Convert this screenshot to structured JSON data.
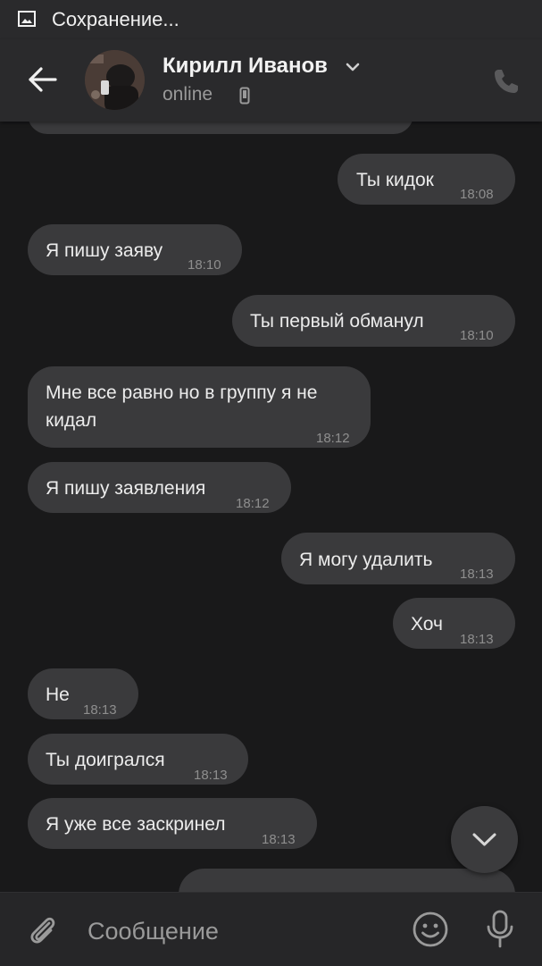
{
  "status_bar": {
    "text": "Сохранение...",
    "icon": "image-icon"
  },
  "header": {
    "back_icon": "arrow-left-icon",
    "contact_name": "Кирилл Иванов",
    "status": "online",
    "status_icon": "mobile-phone-icon",
    "call_icon": "phone-icon"
  },
  "messages": [
    {
      "side": "out",
      "text": "Ты кидок",
      "time": "18:08"
    },
    {
      "side": "in",
      "text": "Я пишу заяву",
      "time": "18:10"
    },
    {
      "side": "out",
      "text": "Ты первый обманул",
      "time": "18:10"
    },
    {
      "side": "in",
      "text": "Мне все равно но в группу я не кидал",
      "time": "18:12"
    },
    {
      "side": "in",
      "text": "Я пишу заявления",
      "time": "18:12"
    },
    {
      "side": "out",
      "text": "Я могу удалить",
      "time": "18:13"
    },
    {
      "side": "out",
      "text": "Хоч",
      "time": "18:13"
    },
    {
      "side": "in",
      "text": "Не",
      "time": "18:13"
    },
    {
      "side": "in",
      "text": "Ты доигрался",
      "time": "18:13"
    },
    {
      "side": "in",
      "text": "Я уже все заскринел",
      "time": "18:13"
    }
  ],
  "composer": {
    "placeholder": "Сообщение",
    "attach_icon": "paperclip-icon",
    "emoji_icon": "smiley-icon",
    "mic_icon": "microphone-icon"
  },
  "scroll_down_icon": "chevron-down-icon",
  "colors": {
    "background": "#19191a",
    "header": "#2a2a2c",
    "bubble": "#3a3a3c",
    "time_text": "#8e8e8e"
  }
}
